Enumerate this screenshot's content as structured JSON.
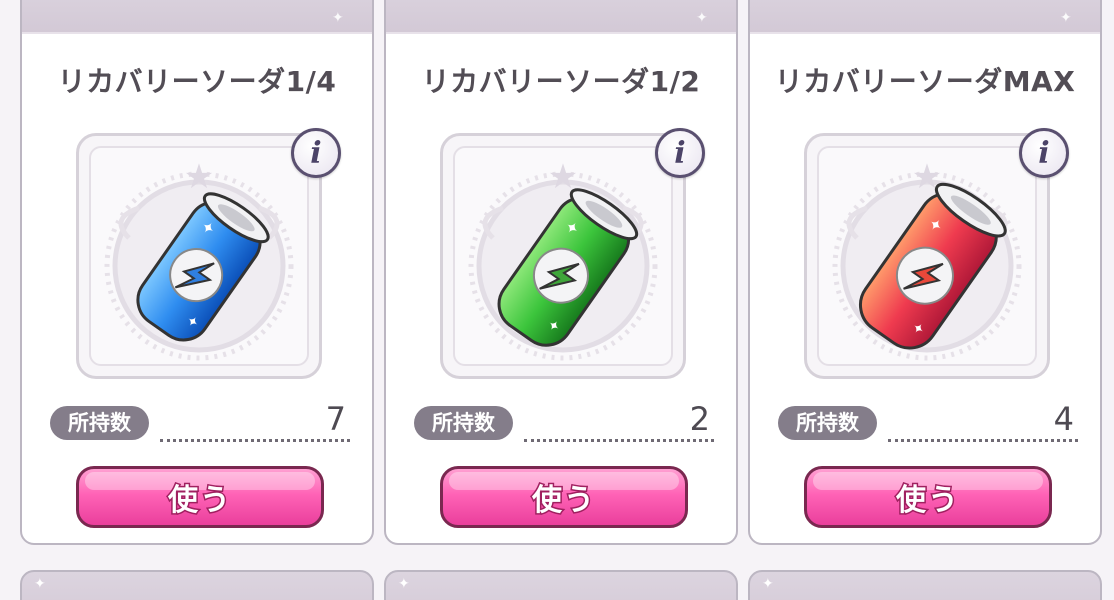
{
  "items": [
    {
      "name": "リカバリーソーダ1/4",
      "owned_label": "所持数",
      "owned_count": "7",
      "use_label": "使う",
      "info_label": "i",
      "color": "blue"
    },
    {
      "name": "リカバリーソーダ1/2",
      "owned_label": "所持数",
      "owned_count": "2",
      "use_label": "使う",
      "info_label": "i",
      "color": "green"
    },
    {
      "name": "リカバリーソーダMAX",
      "owned_label": "所持数",
      "owned_count": "4",
      "use_label": "使う",
      "info_label": "i",
      "color": "red"
    }
  ],
  "colors": {
    "blue": {
      "light": "#7cc7ff",
      "mid": "#2f8df0",
      "dark": "#0b4fb8",
      "bolt": "#2f7fe0"
    },
    "green": {
      "light": "#8ee87a",
      "mid": "#3cc53c",
      "dark": "#177a1d",
      "bolt": "#3fa63a"
    },
    "red": {
      "light": "#ff9b6b",
      "mid": "#ef3b4f",
      "dark": "#b01838",
      "bolt": "#e8483a"
    }
  }
}
